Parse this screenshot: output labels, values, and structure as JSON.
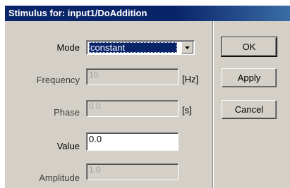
{
  "window": {
    "title": "Stimulus for: input1/DoAddition"
  },
  "form": {
    "mode": {
      "label": "Mode",
      "value": "constant"
    },
    "frequency": {
      "label": "Frequency",
      "value": "10",
      "unit": "[Hz]"
    },
    "phase": {
      "label": "Phase",
      "value": "0.0",
      "unit": "[s]"
    },
    "value": {
      "label": "Value",
      "value": "0.0"
    },
    "amplitude": {
      "label": "Amplitude",
      "value": "1.0"
    }
  },
  "buttons": {
    "ok": "OK",
    "apply": "Apply",
    "cancel": "Cancel"
  },
  "icons": {
    "dropdown": "chevron-down-icon"
  },
  "colors": {
    "titlebar": "#0a246a",
    "dialog_bg": "#d4d0c8",
    "selection": "#0a246a"
  }
}
